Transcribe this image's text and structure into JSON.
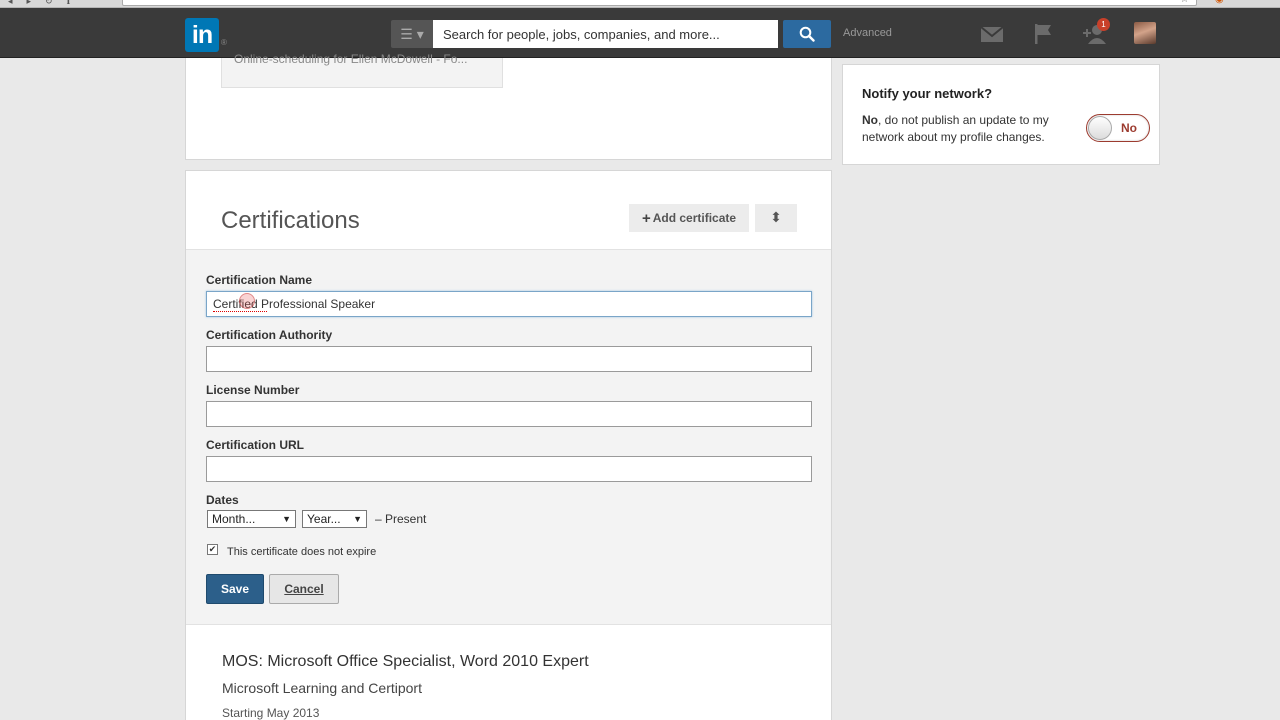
{
  "topbar": {
    "logo_text": "in",
    "logo_sup": "®",
    "search_placeholder": "Search for people, jobs, companies, and more...",
    "advanced_label": "Advanced",
    "notification_count": "1"
  },
  "previous_section": {
    "item_text": "Online-scheduling for Ellen McDowell - Fo..."
  },
  "certifications": {
    "title": "Certifications",
    "add_label": "Add certificate",
    "form": {
      "name_label": "Certification Name",
      "name_value": "Certified Professional Speaker",
      "authority_label": "Certification Authority",
      "authority_value": "",
      "license_label": "License Number",
      "license_value": "",
      "url_label": "Certification URL",
      "url_value": "",
      "dates_label": "Dates",
      "month_selected": "Month...",
      "year_selected": "Year...",
      "present_text": "– Present",
      "no_expire_label": "This certificate does not expire",
      "no_expire_checked": true,
      "save_label": "Save",
      "cancel_label": "Cancel"
    },
    "existing": [
      {
        "name": "MOS: Microsoft Office Specialist, Word 2010 Expert",
        "authority": "Microsoft Learning and Certiport",
        "date": "Starting May 2013"
      }
    ]
  },
  "notify": {
    "title": "Notify your network?",
    "text_bold": "No",
    "text_rest": ", do not publish an update to my network about my profile changes.",
    "toggle_label": "No"
  },
  "colors": {
    "brand_blue": "#0077b5",
    "save_blue": "#2c5f8a",
    "toggle_red": "#9c3b2f",
    "topbar_bg": "#3a3a3a"
  }
}
